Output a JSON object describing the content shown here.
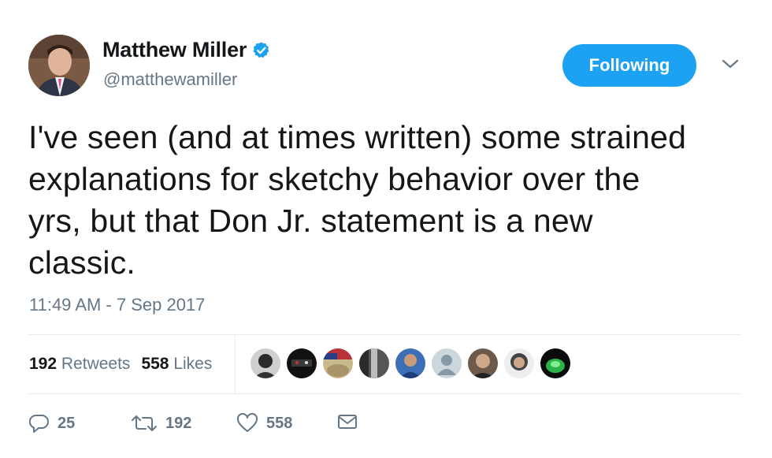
{
  "user": {
    "name": "Matthew Miller",
    "handle": "@matthewamiller",
    "verified": true
  },
  "follow_button": {
    "label": "Following"
  },
  "tweet": {
    "lines": [
      "I've seen (and at times written) some strained",
      "explanations for sketchy behavior over the",
      "yrs, but that Don Jr. statement is a new",
      "classic."
    ],
    "timestamp": "11:49 AM - 7 Sep 2017"
  },
  "stats": {
    "retweets_count": "192",
    "retweets_label": "Retweets",
    "likes_count": "558",
    "likes_label": "Likes"
  },
  "actions": {
    "reply_count": "25",
    "retweet_count": "192",
    "like_count": "558"
  },
  "colors": {
    "accent": "#1da1f2",
    "secondary_text": "#657786",
    "primary_text": "#14171a"
  },
  "icons": [
    "verified-badge-icon",
    "chevron-down-icon",
    "reply-icon",
    "retweet-icon",
    "heart-icon",
    "envelope-icon"
  ]
}
